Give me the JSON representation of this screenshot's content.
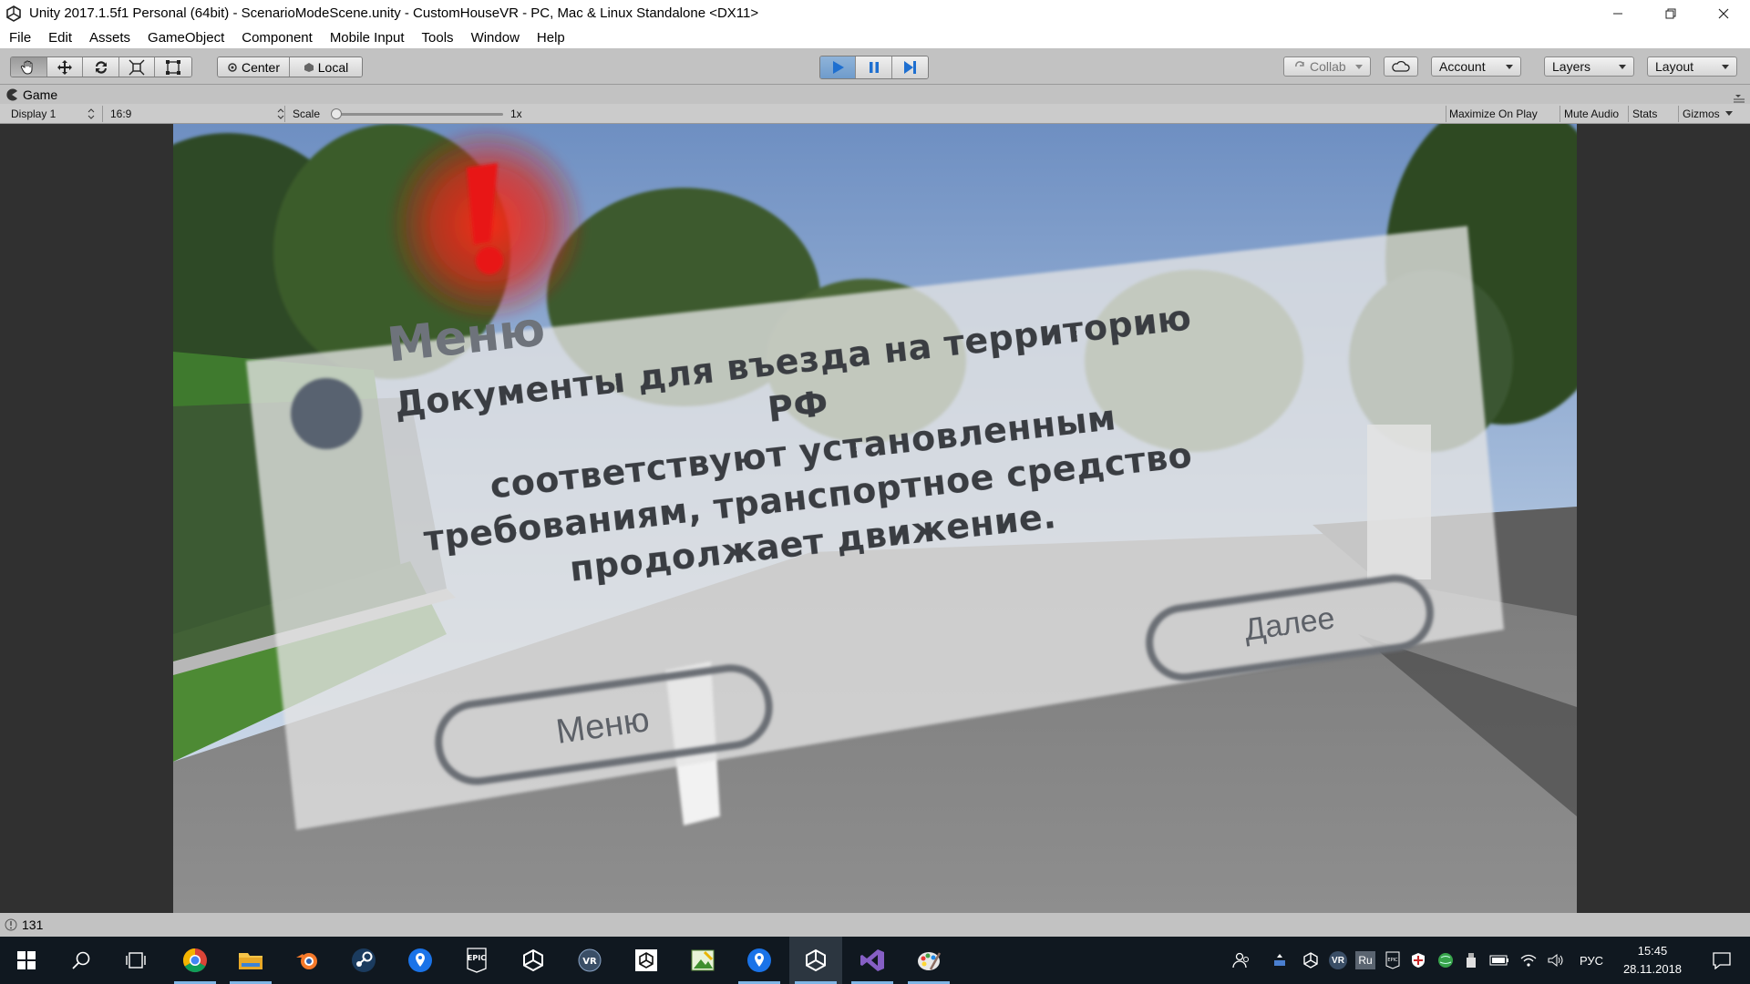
{
  "window": {
    "title": "Unity 2017.1.5f1 Personal (64bit) - ScenarioModeScene.unity - CustomHouseVR - PC, Mac & Linux Standalone <DX11>"
  },
  "menu": [
    "File",
    "Edit",
    "Assets",
    "GameObject",
    "Component",
    "Mobile Input",
    "Tools",
    "Window",
    "Help"
  ],
  "toolbar": {
    "pivot_label": "Center",
    "space_label": "Local",
    "collab_label": "Collab",
    "account_label": "Account",
    "layers_label": "Layers",
    "layout_label": "Layout",
    "play_color": "#2e7bd6"
  },
  "game_view": {
    "tab_label": "Game",
    "display": "Display 1",
    "aspect": "16:9",
    "scale_label": "Scale",
    "scale_value": "1x",
    "maximize_label": "Maximize On Play",
    "mute_label": "Mute Audio",
    "stats_label": "Stats",
    "gizmos_label": "Gizmos"
  },
  "dialog": {
    "title": "Меню",
    "message_lines": [
      "Документы для въезда на территорию РФ",
      "соответствуют установленным",
      "требованиям, транспортное средство",
      "продолжает движение."
    ],
    "menu_button": "Меню",
    "next_button": "Далее",
    "alert_symbol": "!"
  },
  "status": {
    "count": "131"
  },
  "taskbar": {
    "apps": [
      "start-icon",
      "search-icon",
      "task-view-icon",
      "chrome-icon",
      "explorer-icon",
      "blender-icon",
      "steam-icon",
      "maps-icon",
      "epic-games-icon",
      "unity-icon",
      "vr-icon",
      "unity-hub-icon",
      "image-viewer-icon",
      "maps-icon-2",
      "unity-editor-icon",
      "visual-studio-icon",
      "paint-icon"
    ],
    "tray": {
      "language": "РУС",
      "lang_badge": "Ru",
      "vr_badge": "VR",
      "time": "15:45",
      "date": "28.11.2018"
    }
  }
}
